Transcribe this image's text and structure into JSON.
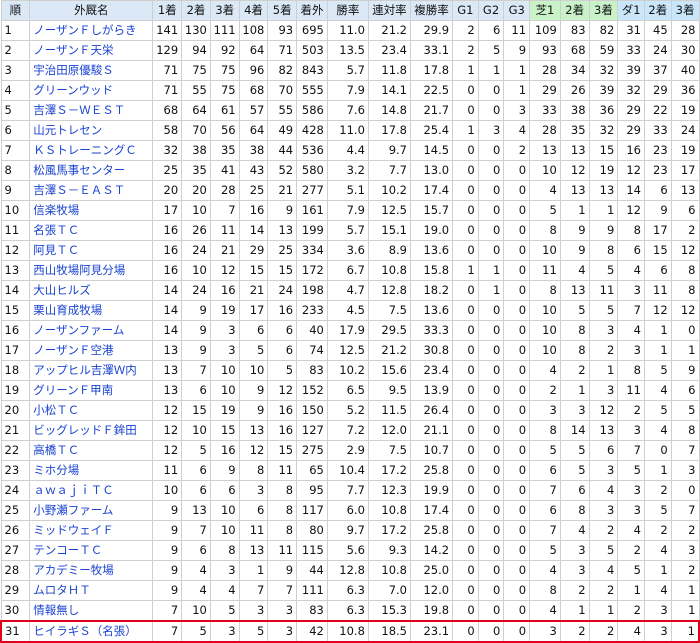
{
  "headers": [
    "順",
    "外厩名",
    "1着",
    "2着",
    "3着",
    "4着",
    "5着",
    "着外",
    "勝率",
    "連対率",
    "複勝率",
    "G1",
    "G2",
    "G3",
    "芝1",
    "2着",
    "3着",
    "ダ1",
    "2着",
    "3着"
  ],
  "rows": [
    [
      "1",
      "ノーザンＦしがらき",
      "141",
      "130",
      "111",
      "108",
      "93",
      "695",
      "11.0",
      "21.2",
      "29.9",
      "2",
      "6",
      "11",
      "109",
      "83",
      "82",
      "31",
      "45",
      "28"
    ],
    [
      "2",
      "ノーザンＦ天栄",
      "129",
      "94",
      "92",
      "64",
      "71",
      "503",
      "13.5",
      "23.4",
      "33.1",
      "2",
      "5",
      "9",
      "93",
      "68",
      "59",
      "33",
      "24",
      "30"
    ],
    [
      "3",
      "宇治田原優駿Ｓ",
      "71",
      "75",
      "75",
      "96",
      "82",
      "843",
      "5.7",
      "11.8",
      "17.8",
      "1",
      "1",
      "1",
      "28",
      "34",
      "32",
      "39",
      "37",
      "40"
    ],
    [
      "4",
      "グリーンウッド",
      "71",
      "55",
      "75",
      "68",
      "70",
      "555",
      "7.9",
      "14.1",
      "22.5",
      "0",
      "0",
      "1",
      "29",
      "26",
      "39",
      "32",
      "29",
      "36"
    ],
    [
      "5",
      "吉澤Ｓ－ＷＥＳＴ",
      "68",
      "64",
      "61",
      "57",
      "55",
      "586",
      "7.6",
      "14.8",
      "21.7",
      "0",
      "0",
      "3",
      "33",
      "38",
      "36",
      "29",
      "22",
      "19"
    ],
    [
      "6",
      "山元トレセン",
      "58",
      "70",
      "56",
      "64",
      "49",
      "428",
      "11.0",
      "17.8",
      "25.4",
      "1",
      "3",
      "4",
      "28",
      "35",
      "32",
      "29",
      "33",
      "24"
    ],
    [
      "7",
      "ＫＳトレーニングＣ",
      "32",
      "38",
      "35",
      "38",
      "44",
      "536",
      "4.4",
      "9.7",
      "14.5",
      "0",
      "0",
      "2",
      "13",
      "13",
      "15",
      "16",
      "23",
      "19"
    ],
    [
      "8",
      "松風馬事センター",
      "25",
      "35",
      "41",
      "43",
      "52",
      "580",
      "3.2",
      "7.7",
      "13.0",
      "0",
      "0",
      "0",
      "10",
      "12",
      "19",
      "12",
      "23",
      "17"
    ],
    [
      "9",
      "吉澤Ｓ－ＥＡＳＴ",
      "20",
      "20",
      "28",
      "25",
      "21",
      "277",
      "5.1",
      "10.2",
      "17.4",
      "0",
      "0",
      "0",
      "4",
      "13",
      "13",
      "14",
      "6",
      "13"
    ],
    [
      "10",
      "信楽牧場",
      "17",
      "10",
      "7",
      "16",
      "9",
      "161",
      "7.9",
      "12.5",
      "15.7",
      "0",
      "0",
      "0",
      "5",
      "1",
      "1",
      "12",
      "9",
      "6"
    ],
    [
      "11",
      "名張ＴＣ",
      "16",
      "26",
      "11",
      "14",
      "13",
      "199",
      "5.7",
      "15.1",
      "19.0",
      "0",
      "0",
      "0",
      "8",
      "9",
      "9",
      "8",
      "17",
      "2"
    ],
    [
      "12",
      "阿見ＴＣ",
      "16",
      "24",
      "21",
      "29",
      "25",
      "334",
      "3.6",
      "8.9",
      "13.6",
      "0",
      "0",
      "0",
      "10",
      "9",
      "8",
      "6",
      "15",
      "12"
    ],
    [
      "13",
      "西山牧場阿見分場",
      "16",
      "10",
      "12",
      "15",
      "15",
      "172",
      "6.7",
      "10.8",
      "15.8",
      "1",
      "1",
      "0",
      "11",
      "4",
      "5",
      "4",
      "6",
      "8"
    ],
    [
      "14",
      "大山ヒルズ",
      "14",
      "24",
      "16",
      "21",
      "24",
      "198",
      "4.7",
      "12.8",
      "18.2",
      "0",
      "1",
      "0",
      "8",
      "13",
      "11",
      "3",
      "11",
      "8"
    ],
    [
      "15",
      "栗山育成牧場",
      "14",
      "9",
      "19",
      "17",
      "16",
      "233",
      "4.5",
      "7.5",
      "13.6",
      "0",
      "0",
      "0",
      "10",
      "5",
      "5",
      "7",
      "12",
      "12"
    ],
    [
      "16",
      "ノーザンファーム",
      "14",
      "9",
      "3",
      "6",
      "6",
      "40",
      "17.9",
      "29.5",
      "33.3",
      "0",
      "0",
      "0",
      "10",
      "8",
      "3",
      "4",
      "1",
      "0"
    ],
    [
      "17",
      "ノーザンＦ空港",
      "13",
      "9",
      "3",
      "5",
      "6",
      "74",
      "12.5",
      "21.2",
      "30.8",
      "0",
      "0",
      "0",
      "10",
      "8",
      "2",
      "3",
      "1",
      "1"
    ],
    [
      "18",
      "アップヒル吉澤Ｗ内",
      "13",
      "7",
      "10",
      "10",
      "5",
      "83",
      "10.2",
      "15.6",
      "23.4",
      "0",
      "0",
      "0",
      "4",
      "2",
      "1",
      "8",
      "5",
      "9"
    ],
    [
      "19",
      "グリーンＦ甲南",
      "13",
      "6",
      "10",
      "9",
      "12",
      "152",
      "6.5",
      "9.5",
      "13.9",
      "0",
      "0",
      "0",
      "2",
      "1",
      "3",
      "11",
      "4",
      "6"
    ],
    [
      "20",
      "小松ＴＣ",
      "12",
      "15",
      "19",
      "9",
      "16",
      "150",
      "5.2",
      "11.5",
      "26.4",
      "0",
      "0",
      "0",
      "3",
      "3",
      "12",
      "2",
      "5",
      "5"
    ],
    [
      "21",
      "ビッグレッドＦ鉾田",
      "12",
      "10",
      "15",
      "13",
      "16",
      "127",
      "7.2",
      "12.0",
      "21.1",
      "0",
      "0",
      "0",
      "8",
      "14",
      "13",
      "3",
      "4",
      "8"
    ],
    [
      "22",
      "高橋ＴＣ",
      "12",
      "5",
      "16",
      "12",
      "15",
      "275",
      "2.9",
      "7.5",
      "10.7",
      "0",
      "0",
      "0",
      "5",
      "5",
      "6",
      "7",
      "0",
      "7"
    ],
    [
      "23",
      "ミホ分場",
      "11",
      "6",
      "9",
      "8",
      "11",
      "65",
      "10.4",
      "17.2",
      "25.8",
      "0",
      "0",
      "0",
      "6",
      "5",
      "3",
      "5",
      "1",
      "3"
    ],
    [
      "24",
      "ａｗａｊｉＴＣ",
      "10",
      "6",
      "6",
      "3",
      "8",
      "95",
      "7.7",
      "12.3",
      "19.9",
      "0",
      "0",
      "0",
      "7",
      "6",
      "4",
      "3",
      "2",
      "0"
    ],
    [
      "25",
      "小野瀬ファーム",
      "9",
      "13",
      "10",
      "6",
      "8",
      "117",
      "6.0",
      "10.8",
      "17.4",
      "0",
      "0",
      "0",
      "6",
      "8",
      "3",
      "3",
      "5",
      "7"
    ],
    [
      "26",
      "ミッドウェイＦ",
      "9",
      "7",
      "10",
      "11",
      "8",
      "80",
      "9.7",
      "17.2",
      "25.8",
      "0",
      "0",
      "0",
      "7",
      "4",
      "2",
      "4",
      "2",
      "2"
    ],
    [
      "27",
      "テンコーＴＣ",
      "9",
      "6",
      "8",
      "13",
      "11",
      "115",
      "5.6",
      "9.3",
      "14.2",
      "0",
      "0",
      "0",
      "5",
      "3",
      "5",
      "2",
      "4",
      "3"
    ],
    [
      "28",
      "アカデミー牧場",
      "9",
      "4",
      "3",
      "1",
      "9",
      "44",
      "12.8",
      "10.8",
      "25.0",
      "0",
      "0",
      "0",
      "4",
      "3",
      "4",
      "5",
      "1",
      "2"
    ],
    [
      "29",
      "ムロタＨＴ",
      "9",
      "4",
      "4",
      "7",
      "7",
      "111",
      "6.3",
      "7.0",
      "12.0",
      "0",
      "0",
      "0",
      "8",
      "2",
      "2",
      "1",
      "4",
      "1"
    ],
    [
      "30",
      "情報無し",
      "7",
      "10",
      "5",
      "3",
      "3",
      "83",
      "6.3",
      "15.3",
      "19.8",
      "0",
      "0",
      "0",
      "4",
      "1",
      "1",
      "2",
      "3",
      "1"
    ],
    [
      "31",
      "ヒイラギＳ（名張）",
      "7",
      "5",
      "3",
      "5",
      "3",
      "42",
      "10.8",
      "18.5",
      "23.1",
      "0",
      "0",
      "0",
      "3",
      "2",
      "2",
      "4",
      "3",
      "1"
    ]
  ],
  "highlight_row_index": 30
}
